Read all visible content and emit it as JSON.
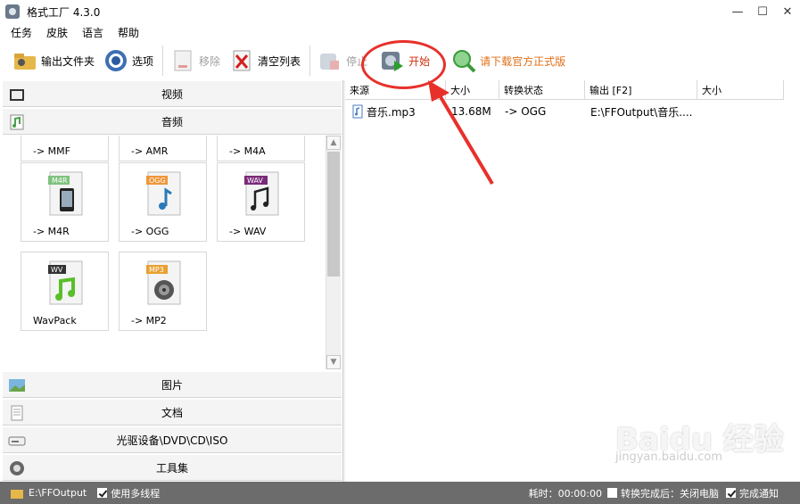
{
  "window": {
    "title": "格式工厂 4.3.0",
    "minimize": "—",
    "maximize": "☐",
    "close": "✕"
  },
  "menu": [
    "任务",
    "皮肤",
    "语言",
    "帮助"
  ],
  "toolbar": {
    "output_folder": "输出文件夹",
    "options": "选项",
    "remove": "移除",
    "clear_list": "清空列表",
    "stop": "停止",
    "start": "开始",
    "download": "请下载官方正式版"
  },
  "categories": {
    "video": "视频",
    "audio": "音频",
    "image": "图片",
    "document": "文档",
    "rom": "光驱设备\\DVD\\CD\\ISO",
    "tools": "工具集"
  },
  "audio_tiles": {
    "top_row": [
      "-> MMF",
      "-> AMR",
      "-> M4A"
    ],
    "tiles": [
      {
        "badge": "M4R",
        "label": "-> M4R",
        "icon": "iphone-icon",
        "color": "#7fc27f"
      },
      {
        "badge": "OGG",
        "label": "-> OGG",
        "icon": "music-note-icon",
        "color": "#f0963a"
      },
      {
        "badge": "WAV",
        "label": "-> WAV",
        "icon": "music-notes-icon",
        "color": "#7a2a7a"
      },
      {
        "badge": "WV",
        "label": "WavPack",
        "icon": "music-note-icon",
        "color": "#333333"
      },
      {
        "badge": "MP3",
        "label": "-> MP2",
        "icon": "speaker-icon",
        "color": "#e8a030"
      }
    ]
  },
  "file_list": {
    "columns": [
      "来源",
      "大小",
      "转换状态",
      "输出 [F2]",
      "大小"
    ],
    "rows": [
      {
        "source": "音乐.mp3",
        "size": "13.68M",
        "status": "-> OGG",
        "output": "E:\\FFOutput\\音乐....",
        "out_size": ""
      }
    ]
  },
  "statusbar": {
    "output_path": "E:\\FFOutput",
    "multithread": "使用多线程",
    "elapsed": "耗时：00:00:00",
    "after_convert": "转换完成后：关闭电脑",
    "notify": "完成通知"
  },
  "watermark": {
    "brand": "Baidu 经验",
    "url": "jingyan.baidu.com"
  },
  "colors": {
    "annotation": "#e8302a",
    "statusbar": "#6c6c6c",
    "download_link": "#e0701a"
  }
}
